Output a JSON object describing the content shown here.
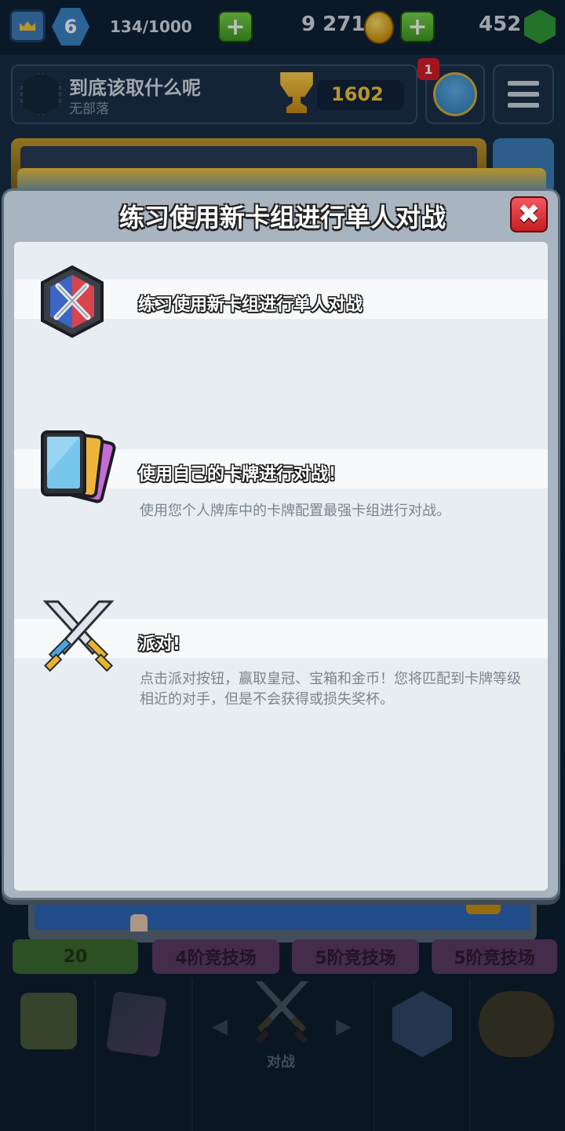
{
  "top_bar": {
    "king_level": "6",
    "experience": "134/1000",
    "gold": "9 271",
    "gems": "452"
  },
  "profile": {
    "player_name": "到底该取什么呢",
    "clan_name": "无部落",
    "trophies": "1602",
    "notification_count": "1"
  },
  "background_tiles": {
    "gems_cost": "20",
    "tile_2": "4阶竞技场",
    "tile_3": "5阶竞技场",
    "tile_4": "5阶竞技场"
  },
  "bottom_nav": {
    "battle_label": "对战",
    "arrow_left": "◀",
    "arrow_right": "▶"
  },
  "modal": {
    "title": "练习使用新卡组进行单人对战",
    "close_label": "✖",
    "items": [
      {
        "icon": "training-shield-icon",
        "title": "练习使用新卡组进行单人对战",
        "description": ""
      },
      {
        "icon": "cards-icon",
        "title": "使用自己的卡牌进行对战！",
        "description": "使用您个人牌库中的卡牌配置最强卡组进行对战。"
      },
      {
        "icon": "crossed-swords-icon",
        "title": "派对!",
        "description": "点击派对按钮，赢取皇冠、宝箱和金币！您将匹配到卡牌等级相近的对手，但是不会获得或损失奖杯。"
      }
    ]
  },
  "colors": {
    "close_button": "#d8262c",
    "modal_frame": "#a9b4c1",
    "content_bg": "#e7edf1"
  }
}
